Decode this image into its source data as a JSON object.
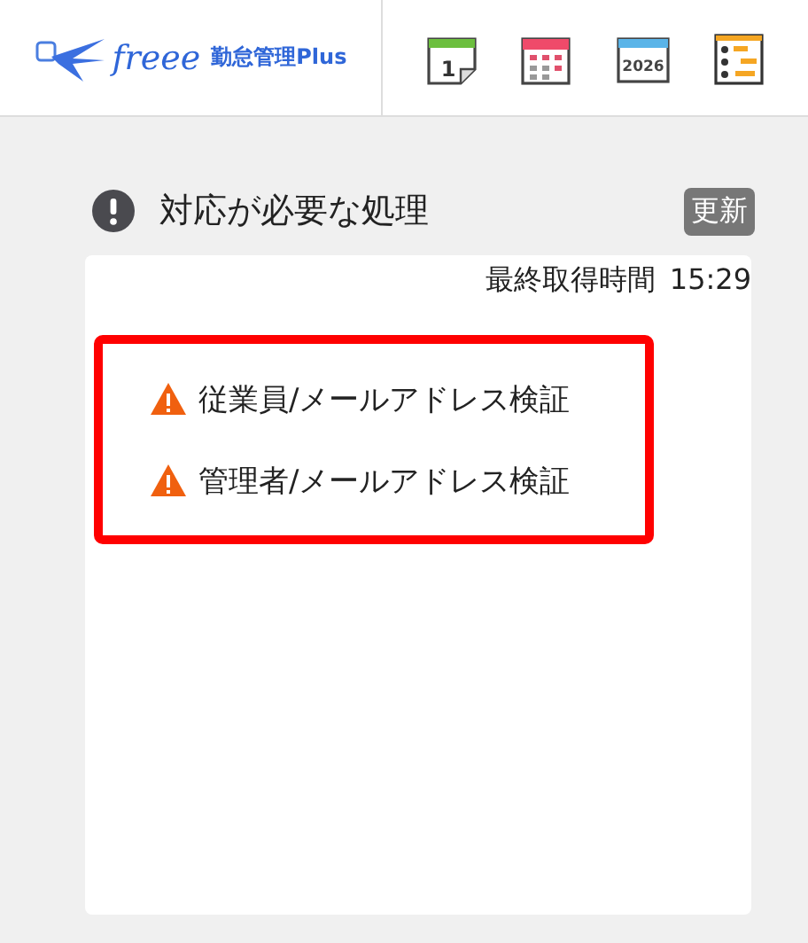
{
  "header": {
    "logo": {
      "brand": "freee",
      "product": "勤怠管理Plus"
    },
    "icons": [
      {
        "kind": "day",
        "label": "1"
      },
      {
        "kind": "month"
      },
      {
        "kind": "year",
        "label": "2026"
      },
      {
        "kind": "schedule"
      }
    ]
  },
  "panel": {
    "title": "対応が必要な処理",
    "refresh_button": "更新",
    "last_fetched_label": "最終取得時間",
    "last_fetched_time": "15:29",
    "tasks": [
      {
        "label": "従業員/メールアドレス検証"
      },
      {
        "label": "管理者/メールアドレス検証"
      }
    ]
  }
}
